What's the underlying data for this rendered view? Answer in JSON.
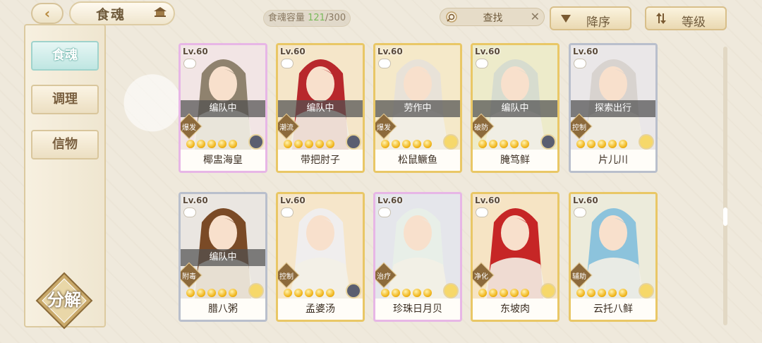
{
  "header": {
    "title": "食魂",
    "capacity_label": "食魂容量",
    "capacity_current": "121",
    "capacity_max": "/300",
    "search_placeholder": "查找",
    "sort_order_label": "降序",
    "sort_key_label": "等级"
  },
  "sidebar": {
    "items": [
      {
        "label": "食魂",
        "active": true
      },
      {
        "label": "调理",
        "active": false
      },
      {
        "label": "信物",
        "active": false
      }
    ],
    "decompose_label": "分解"
  },
  "colors": {
    "accent": "#c7a05a",
    "nav_active": "#bfe6e2",
    "status_overlay": "#505050",
    "capacity_current": "#79b95a"
  },
  "cards": [
    {
      "level": "Lv.60",
      "name": "椰盅海皇",
      "status": "编队中",
      "role": "爆发",
      "frame": "rainbow",
      "hair": "#8f826e",
      "bg": "#f3ede0",
      "badge": "dark"
    },
    {
      "level": "Lv.60",
      "name": "带把肘子",
      "status": "编队中",
      "role": "潮流",
      "frame": "gold",
      "hair": "#b8282c",
      "bg": "#f5e6d7",
      "badge": "dark"
    },
    {
      "level": "Lv.60",
      "name": "松鼠鳜鱼",
      "status": "劳作中",
      "role": "爆发",
      "frame": "gold",
      "hair": "#e8e2d8",
      "bg": "#f4ecd7",
      "badge": "gold"
    },
    {
      "level": "Lv.60",
      "name": "腌笃鲜",
      "status": "编队中",
      "role": "破防",
      "frame": "gold",
      "hair": "#d7dccf",
      "bg": "#e9efd9",
      "badge": "dark"
    },
    {
      "level": "Lv.60",
      "name": "片儿川",
      "status": "探索出行",
      "role": "控制",
      "frame": "silver",
      "hair": "#d8d3cf",
      "bg": "#efe9e6",
      "badge": "gold"
    },
    {
      "level": "Lv.60",
      "name": "腊八粥",
      "status": "编队中",
      "role": "附毒",
      "frame": "silver",
      "hair": "#7a4a26",
      "bg": "#efe6dc",
      "badge": "gold"
    },
    {
      "level": "Lv.60",
      "name": "孟婆汤",
      "status": "",
      "role": "控制",
      "frame": "gold",
      "hair": "#f0eeee",
      "bg": "#f6e7d9",
      "badge": "dark"
    },
    {
      "level": "Lv.60",
      "name": "珍珠日月贝",
      "status": "",
      "role": "治疗",
      "frame": "rainbow",
      "hair": "#e8efe8",
      "bg": "#dfeeea",
      "badge": "gold"
    },
    {
      "level": "Lv.60",
      "name": "东坡肉",
      "status": "",
      "role": "净化",
      "frame": "gold",
      "hair": "#c62626",
      "bg": "#f6e3cf",
      "badge": "gold"
    },
    {
      "level": "Lv.60",
      "name": "云托八鲜",
      "status": "",
      "role": "辅助",
      "frame": "gold",
      "hair": "#8cc3dc",
      "bg": "#e6eff3",
      "badge": "gold"
    }
  ]
}
